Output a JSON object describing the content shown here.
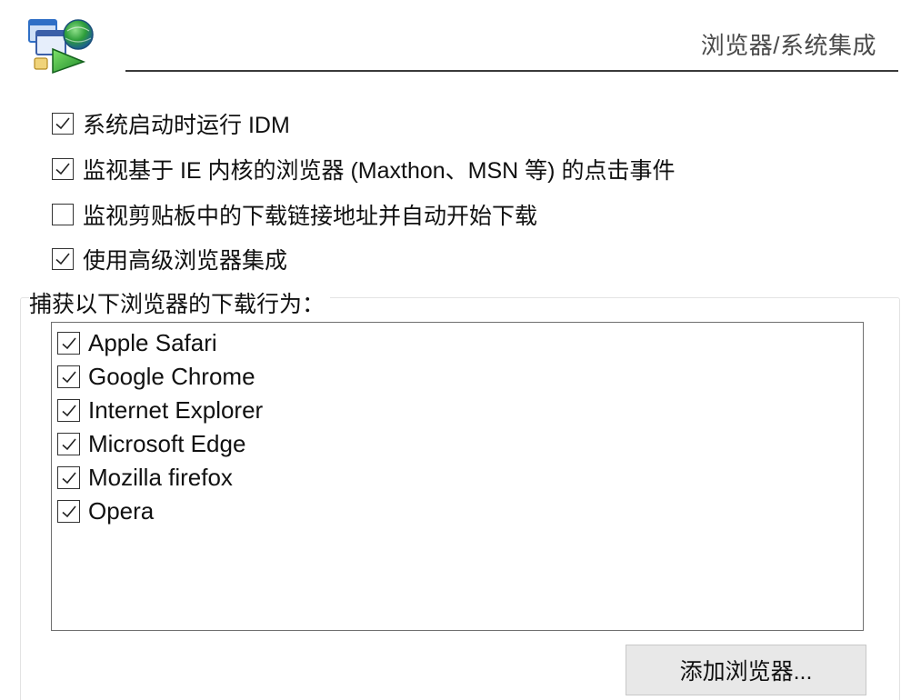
{
  "header": {
    "title": "浏览器/系统集成",
    "logo_icon": "idm-logo-icon"
  },
  "options": [
    {
      "label": "系统启动时运行 IDM",
      "checked": true
    },
    {
      "label": "监视基于 IE 内核的浏览器 (Maxthon、MSN 等) 的点击事件",
      "checked": true
    },
    {
      "label": "监视剪贴板中的下载链接地址并自动开始下载",
      "checked": false
    },
    {
      "label": "使用高级浏览器集成",
      "checked": true
    }
  ],
  "capture_group": {
    "label": "捕获以下浏览器的下载行为：",
    "browsers": [
      {
        "label": "Apple Safari",
        "checked": true
      },
      {
        "label": "Google Chrome",
        "checked": true
      },
      {
        "label": "Internet Explorer",
        "checked": true
      },
      {
        "label": "Microsoft Edge",
        "checked": true
      },
      {
        "label": "Mozilla firefox",
        "checked": true
      },
      {
        "label": "Opera",
        "checked": true
      }
    ],
    "add_button_label": "添加浏览器..."
  },
  "colors": {
    "logo_green": "#2e9e3a",
    "logo_blue": "#2f6fc6",
    "button_bg": "#e8e8e8"
  }
}
